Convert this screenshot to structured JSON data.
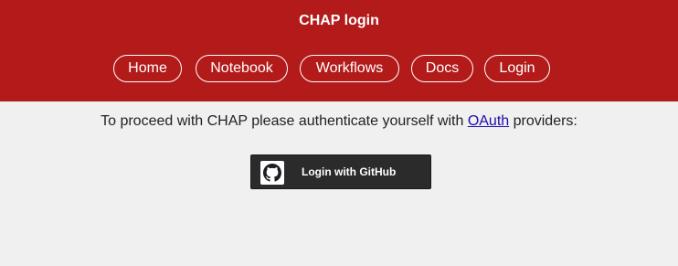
{
  "header": {
    "title": "CHAP login",
    "nav": [
      {
        "label": "Home"
      },
      {
        "label": "Notebook"
      },
      {
        "label": "Workflows"
      },
      {
        "label": "Docs"
      },
      {
        "label": "Login"
      }
    ]
  },
  "main": {
    "intro_before": "To proceed with CHAP please authenticate yourself with ",
    "intro_link": "OAuth",
    "intro_after": " providers:",
    "github_button": {
      "label": "Login with GitHub",
      "icon": "github-icon"
    }
  },
  "colors": {
    "header_bg": "#b31b1b",
    "page_bg": "#f0f0f0",
    "button_dark": "#2b2b2b",
    "link": "#1a0dab"
  }
}
